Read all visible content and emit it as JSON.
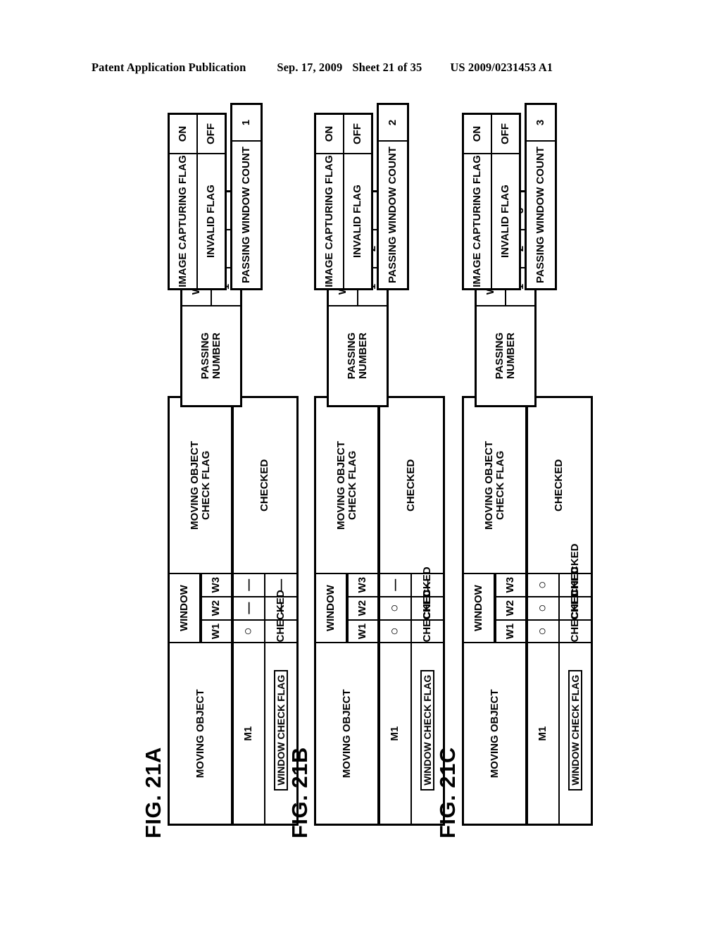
{
  "header": {
    "publication": "Patent Application Publication",
    "date": "Sep. 17, 2009",
    "sheet": "Sheet 21 of 35",
    "patent_number": "US 2009/0231453 A1"
  },
  "common": {
    "col_moving_object": "MOVING OBJECT",
    "col_window": "WINDOW",
    "col_moving_object_check_flag": "MOVING OBJECT\nCHECK FLAG",
    "window_cols": [
      "W1",
      "W2",
      "W3"
    ],
    "row_m1": "M1",
    "row_window_check_flag": "WINDOW CHECK FLAG",
    "label_passing_number": "PASSING\nNUMBER",
    "label_image_capturing_flag": "IMAGE CAPTURING FLAG",
    "label_invalid_flag": "INVALID FLAG",
    "label_passing_window_count": "PASSING WINDOW COUNT",
    "value_checked": "CHECKED",
    "value_circle": "○",
    "value_dash": "—"
  },
  "figures": [
    {
      "label": "FIG. 21A",
      "main": {
        "moving_object_label": "MOVING OBJECT",
        "window_label": "WINDOW",
        "moving_object_check_flag_label": "MOVING OBJECT\nCHECK FLAG",
        "window_headers": [
          "W1",
          "W2",
          "W3"
        ],
        "rows": [
          {
            "name": "M1",
            "nested_label": "",
            "window_values": [
              "○",
              "—",
              "—"
            ],
            "check_flag": "CHECKED"
          },
          {
            "name": "",
            "nested_label": "WINDOW CHECK FLAG",
            "window_values": [
              "CHECKED",
              "—",
              "—"
            ],
            "check_flag": ""
          }
        ]
      },
      "passing_number": {
        "label": "PASSING\nNUMBER",
        "headers": [
          "W1",
          "W2",
          "W3"
        ],
        "values": [
          "1",
          "",
          ""
        ]
      },
      "flags": {
        "image_capturing_flag_label": "IMAGE CAPTURING FLAG",
        "image_capturing_flag_value": "ON",
        "invalid_flag_label": "INVALID FLAG",
        "invalid_flag_value": "OFF"
      },
      "passing_window_count": {
        "label": "PASSING WINDOW COUNT",
        "value": "1"
      }
    },
    {
      "label": "FIG. 21B",
      "main": {
        "moving_object_label": "MOVING OBJECT",
        "window_label": "WINDOW",
        "moving_object_check_flag_label": "MOVING OBJECT\nCHECK FLAG",
        "window_headers": [
          "W1",
          "W2",
          "W3"
        ],
        "rows": [
          {
            "name": "M1",
            "nested_label": "",
            "window_values": [
              "○",
              "○",
              "—"
            ],
            "check_flag": "CHECKED"
          },
          {
            "name": "",
            "nested_label": "WINDOW CHECK FLAG",
            "window_values": [
              "CHECKED",
              "CHECKED",
              "—"
            ],
            "check_flag": ""
          }
        ]
      },
      "passing_number": {
        "label": "PASSING\nNUMBER",
        "headers": [
          "W1",
          "W2",
          "W3"
        ],
        "values": [
          "1",
          "2",
          ""
        ]
      },
      "flags": {
        "image_capturing_flag_label": "IMAGE CAPTURING FLAG",
        "image_capturing_flag_value": "ON",
        "invalid_flag_label": "INVALID FLAG",
        "invalid_flag_value": "OFF"
      },
      "passing_window_count": {
        "label": "PASSING WINDOW COUNT",
        "value": "2"
      }
    },
    {
      "label": "FIG. 21C",
      "main": {
        "moving_object_label": "MOVING OBJECT",
        "window_label": "WINDOW",
        "moving_object_check_flag_label": "MOVING OBJECT\nCHECK FLAG",
        "window_headers": [
          "W1",
          "W2",
          "W3"
        ],
        "rows": [
          {
            "name": "M1",
            "nested_label": "",
            "window_values": [
              "○",
              "○",
              "○"
            ],
            "check_flag": "CHECKED"
          },
          {
            "name": "",
            "nested_label": "WINDOW CHECK FLAG",
            "window_values": [
              "CHECKED",
              "CHECKED",
              "CHECKED"
            ],
            "check_flag": ""
          }
        ]
      },
      "passing_number": {
        "label": "PASSING\nNUMBER",
        "headers": [
          "W1",
          "W2",
          "W3"
        ],
        "values": [
          "1",
          "2",
          "3"
        ]
      },
      "flags": {
        "image_capturing_flag_label": "IMAGE CAPTURING FLAG",
        "image_capturing_flag_value": "ON",
        "invalid_flag_label": "INVALID FLAG",
        "invalid_flag_value": "OFF"
      },
      "passing_window_count": {
        "label": "PASSING WINDOW COUNT",
        "value": "3"
      }
    }
  ]
}
